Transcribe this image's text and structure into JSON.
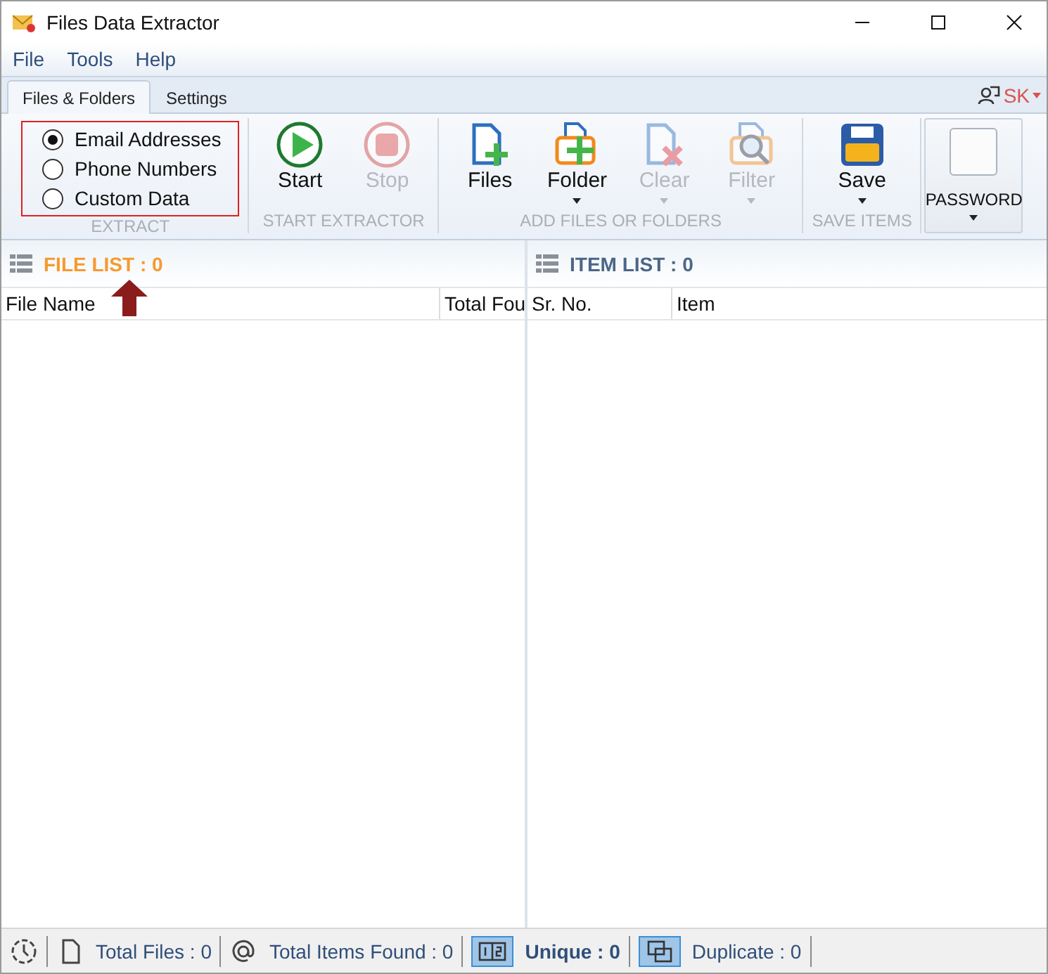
{
  "window": {
    "title": "Files Data Extractor"
  },
  "menu": [
    "File",
    "Tools",
    "Help"
  ],
  "tabs": [
    {
      "label": "Files & Folders",
      "selected": true
    },
    {
      "label": "Settings",
      "selected": false
    }
  ],
  "user": {
    "label": "SK"
  },
  "ribbon": {
    "extract": {
      "label": "EXTRACT",
      "options": [
        {
          "label": "Email Addresses",
          "selected": true
        },
        {
          "label": "Phone Numbers",
          "selected": false
        },
        {
          "label": "Custom Data",
          "selected": false
        }
      ]
    },
    "groups": [
      {
        "label": "START EXTRACTOR",
        "buttons": [
          {
            "kind": "start",
            "label": "Start",
            "disabled": false,
            "dropdown": false
          },
          {
            "kind": "stop",
            "label": "Stop",
            "disabled": true,
            "dropdown": false
          }
        ]
      },
      {
        "label": "ADD FILES OR FOLDERS",
        "buttons": [
          {
            "kind": "files",
            "label": "Files",
            "disabled": false,
            "dropdown": false
          },
          {
            "kind": "folder",
            "label": "Folder",
            "disabled": false,
            "dropdown": true
          },
          {
            "kind": "clear",
            "label": "Clear",
            "disabled": true,
            "dropdown": true
          },
          {
            "kind": "filter",
            "label": "Filter",
            "disabled": true,
            "dropdown": true
          }
        ]
      },
      {
        "label": "SAVE ITEMS",
        "buttons": [
          {
            "kind": "save",
            "label": "Save",
            "disabled": false,
            "dropdown": true
          }
        ]
      }
    ],
    "password": {
      "label": "PASSWORD"
    }
  },
  "file_list": {
    "title": "FILE LIST : 0",
    "columns": [
      "File Name",
      "Total Fou"
    ]
  },
  "item_list": {
    "title": "ITEM LIST : 0",
    "columns": [
      "Sr. No.",
      "Item"
    ]
  },
  "status_bar": [
    {
      "kind": "clock"
    },
    {
      "kind": "file",
      "text": "Total Files : 0",
      "selected": false
    },
    {
      "kind": "at",
      "text": "Total Items Found : 0",
      "selected": false
    },
    {
      "kind": "unique",
      "text": "Unique : 0",
      "selected": true
    },
    {
      "kind": "duplicate",
      "text": "Duplicate : 0",
      "selected": false
    }
  ]
}
